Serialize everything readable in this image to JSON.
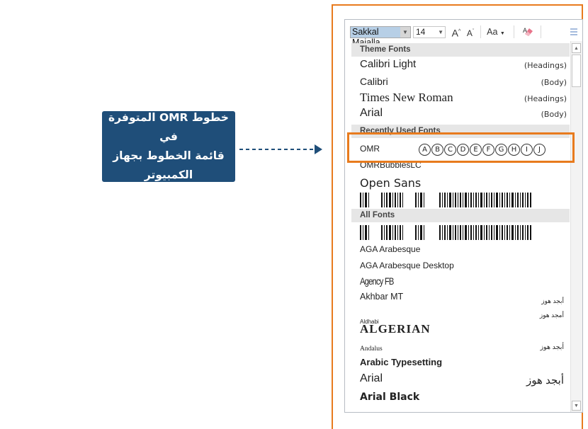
{
  "callout": {
    "text": "خطوط OMR المتوفرة في\nقائمة الخطوط بجهاز الكمبيوتر",
    "bg": "#1f4e79"
  },
  "accent_color": "#e87b1e",
  "toolbar": {
    "font_value": "Sakkal Majalla",
    "size_value": "14",
    "grow_font": "A",
    "shrink_font": "A",
    "change_case": "Aa",
    "icons": [
      "dropdown-arrow-icon",
      "grow-font-icon",
      "shrink-font-icon",
      "change-case-icon",
      "clear-formatting-icon",
      "styles-icon"
    ]
  },
  "sections": {
    "theme": "Theme Fonts",
    "recent": "Recently Used Fonts",
    "all": "All Fonts"
  },
  "theme_fonts": [
    {
      "name": "Calibri Light",
      "tag": "(Headings)"
    },
    {
      "name": "Calibri",
      "tag": "(Body)"
    },
    {
      "name": "Times New Roman",
      "tag": "(Headings)"
    },
    {
      "name": "Arial",
      "tag": "(Body)"
    }
  ],
  "recent_fonts": {
    "omr": {
      "name": "OMR",
      "bubbles": [
        "A",
        "B",
        "C",
        "D",
        "E",
        "F",
        "G",
        "H",
        "I",
        "J"
      ]
    },
    "omr_lc": "OMRBubblesLC",
    "open_sans": "Open Sans"
  },
  "all_fonts": {
    "aga": "AGA Arabesque",
    "aga_desktop": "AGA Arabesque Desktop",
    "agency": "Agency FB",
    "akhbar": {
      "name": "Akhbar MT",
      "sample": "أبجد هوز"
    },
    "aldhabi": {
      "name": "Aldhabi",
      "sample": "أمجد هوز"
    },
    "algerian": "ALGERIAN",
    "andalus": {
      "name": "Andalus",
      "sample": "أبجد هوز"
    },
    "arabic_typesetting": "Arabic Typesetting",
    "arial": {
      "name": "Arial",
      "sample": "أبجد هوز"
    },
    "arial_black": "Arial Black"
  },
  "more_indicator": "...."
}
